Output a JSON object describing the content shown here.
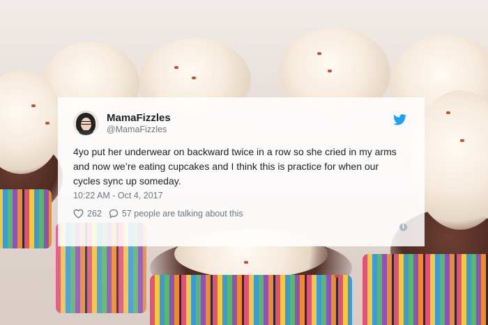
{
  "tweet": {
    "display_name": "MamaFizzles",
    "handle": "@MamaFizzles",
    "text": "4yo put her underwear on backward twice in a row so she cried in my arms and now we’re eating cupcakes and I think this is practice for when our cycles sync up someday.",
    "timestamp": "10:22 AM - Oct 4, 2017",
    "likes": "262",
    "conversation": "57 people are talking about this",
    "info_glyph": "i"
  },
  "icons": {
    "brand": "twitter-bird-icon",
    "like": "heart-icon",
    "reply": "speech-bubble-icon",
    "info": "info-icon"
  },
  "colors": {
    "twitter_blue": "#1da1f2",
    "meta_gray": "#697882",
    "text_dark": "#1c2022"
  }
}
